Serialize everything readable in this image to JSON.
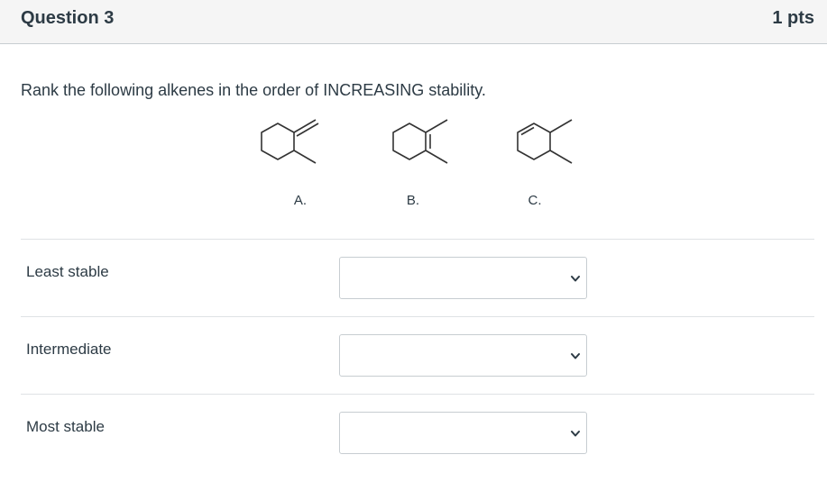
{
  "header": {
    "title": "Question 3",
    "points": "1 pts"
  },
  "prompt": "Rank the following alkenes in the order of INCREASING stability.",
  "molecules": [
    {
      "label": "A."
    },
    {
      "label": "B."
    },
    {
      "label": "C."
    }
  ],
  "rows": [
    {
      "label": "Least stable",
      "selected": ""
    },
    {
      "label": "Intermediate",
      "selected": ""
    },
    {
      "label": "Most stable",
      "selected": ""
    }
  ],
  "icons": {
    "dropdown": "chevron-down-icon"
  },
  "colors": {
    "text": "#2d3b45",
    "header_bg": "#f5f5f5",
    "border": "#c7cdd1"
  }
}
